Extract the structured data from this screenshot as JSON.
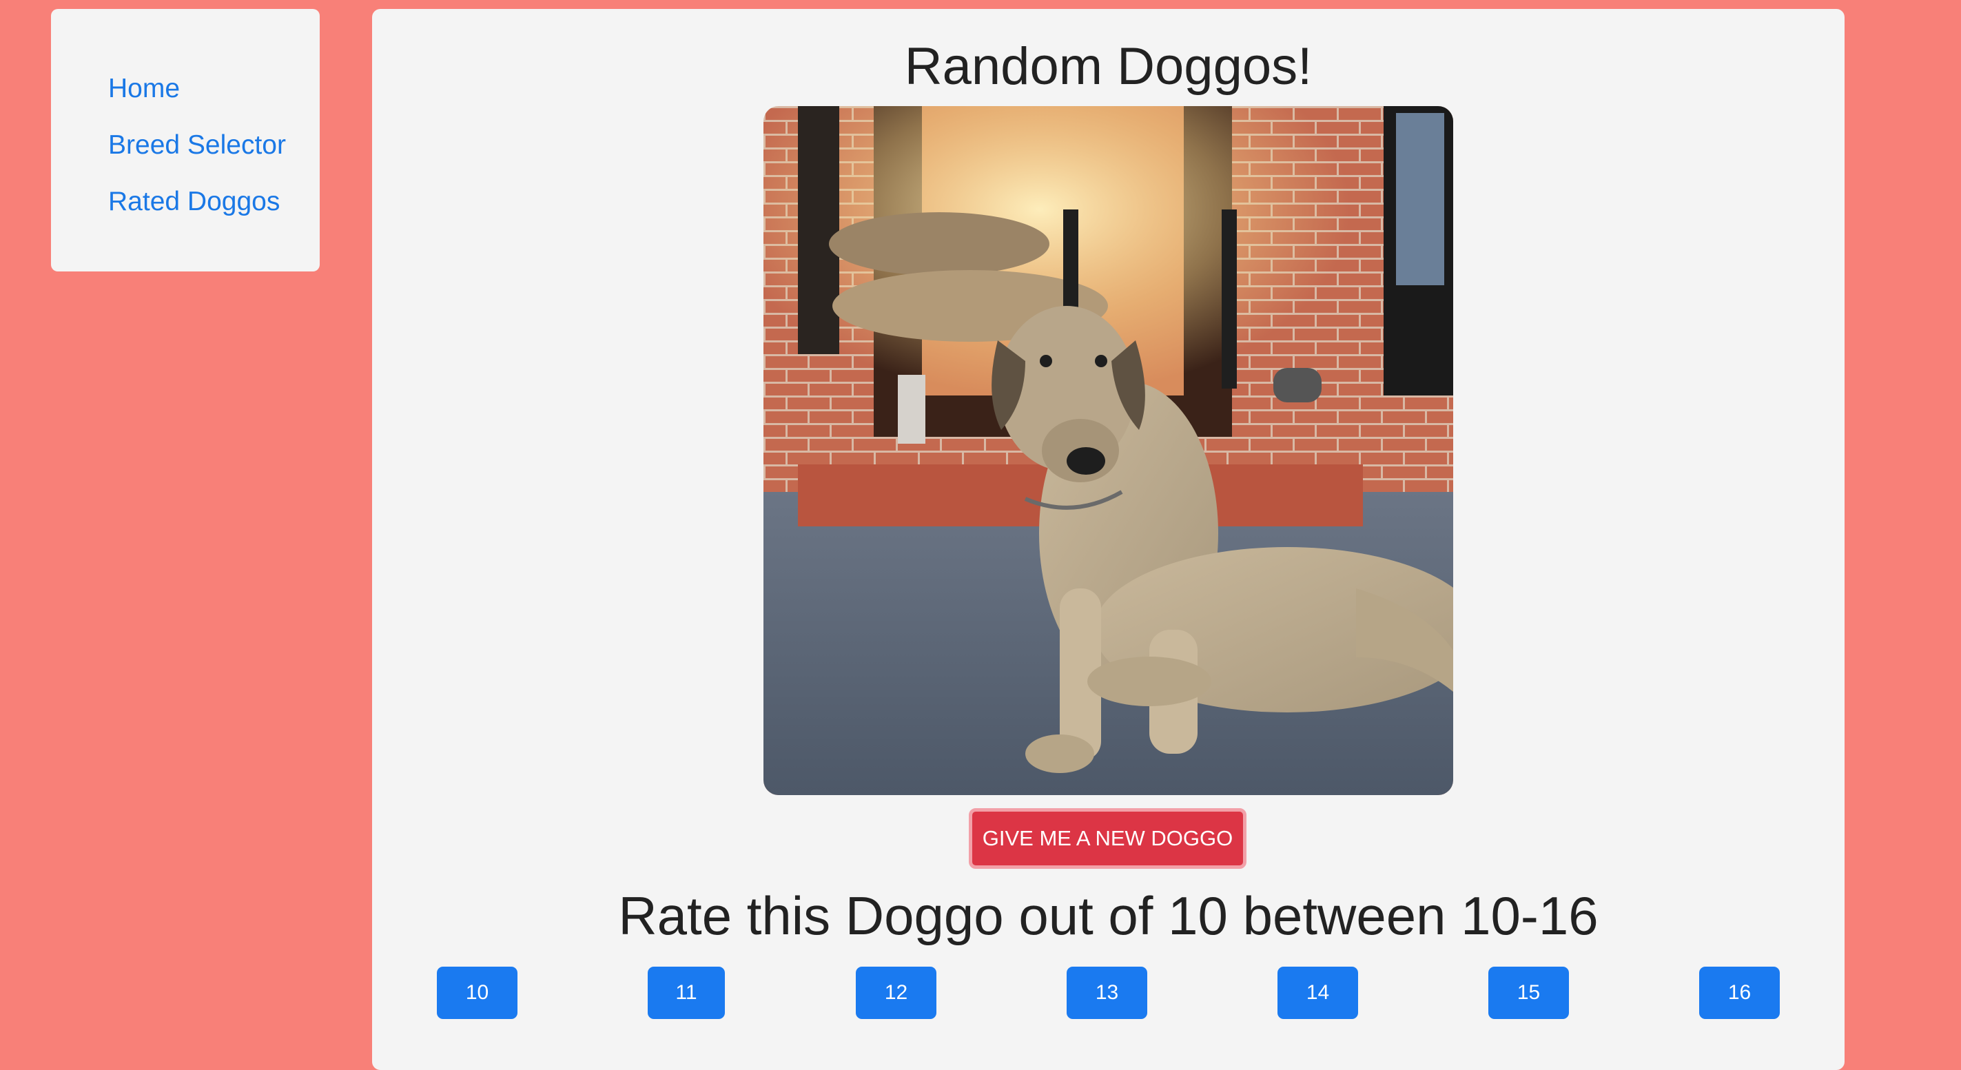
{
  "nav": {
    "items": [
      {
        "label": "Home"
      },
      {
        "label": "Breed Selector"
      },
      {
        "label": "Rated Doggos"
      }
    ]
  },
  "main": {
    "title": "Random Doggos!",
    "new_button_label": "GIVE ME A NEW DOGGO",
    "rate_title": "Rate this Doggo out of 10 between 10-16",
    "ratings": [
      "10",
      "11",
      "12",
      "13",
      "14",
      "15",
      "16"
    ]
  },
  "colors": {
    "page_background": "#f88078",
    "panel_background": "#f4f4f4",
    "link": "#1a78e6",
    "danger_button": "#dc3545",
    "primary_button": "#1a7af0"
  }
}
